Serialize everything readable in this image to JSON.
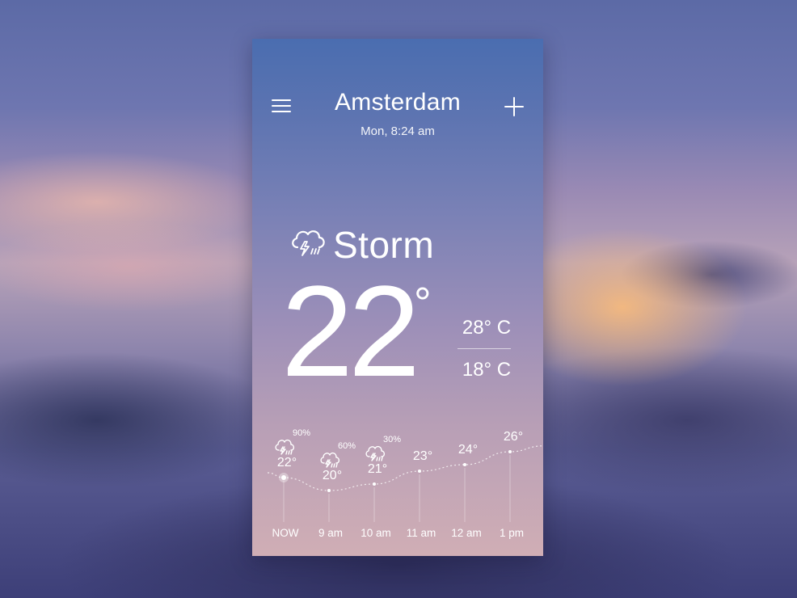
{
  "header": {
    "menu_icon": "hamburger-menu-icon",
    "add_icon": "plus-icon",
    "city": "Amsterdam",
    "datetime": "Mon, 8:24 am"
  },
  "current": {
    "condition_icon": "thunderstorm-cloud-icon",
    "condition": "Storm",
    "temperature": "22",
    "degree_symbol": "°",
    "high": "28° C",
    "low": "18° C"
  },
  "forecast": {
    "hours": [
      {
        "label": "NOW",
        "temp": "22°",
        "precip": "90%",
        "icon": "thunderstorm-icon",
        "value": 22
      },
      {
        "label": "9 am",
        "temp": "20°",
        "precip": "60%",
        "icon": "thunderstorm-icon",
        "value": 20
      },
      {
        "label": "10 am",
        "temp": "21°",
        "precip": "30%",
        "icon": "thunderstorm-icon",
        "value": 21
      },
      {
        "label": "11 am",
        "temp": "23°",
        "precip": "",
        "icon": "",
        "value": 23
      },
      {
        "label": "12 am",
        "temp": "24°",
        "precip": "",
        "icon": "",
        "value": 24
      },
      {
        "label": "1 pm",
        "temp": "26°",
        "precip": "",
        "icon": "",
        "value": 26
      }
    ]
  }
}
